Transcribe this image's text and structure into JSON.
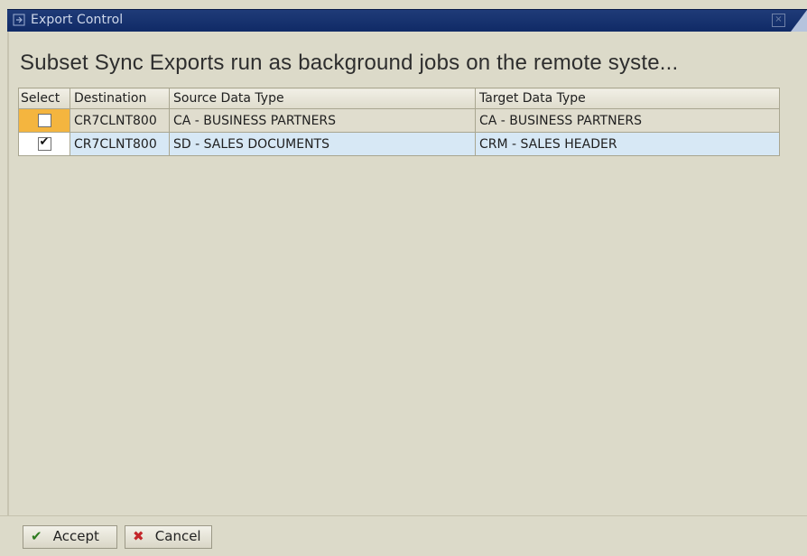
{
  "window": {
    "title": "Export Control"
  },
  "banner": {
    "text": "Subset Sync Exports run as background jobs on the remote syste..."
  },
  "table": {
    "columns": [
      "Select",
      "Destination",
      "Source Data Type",
      "Target Data Type"
    ],
    "rows": [
      {
        "selected": false,
        "destination": "CR7CLNT800",
        "source": "CA - BUSINESS PARTNERS",
        "target": "CA - BUSINESS PARTNERS",
        "checkmark": ""
      },
      {
        "selected": true,
        "destination": "CR7CLNT800",
        "source": "SD - SALES DOCUMENTS",
        "target": "CRM - SALES HEADER",
        "checkmark": "✔"
      }
    ]
  },
  "footer": {
    "accept_label": "Accept",
    "cancel_label": "Cancel",
    "accept_icon": "checkmark-icon",
    "cancel_icon": "cross-icon"
  },
  "colors": {
    "titlebar": "#102a66",
    "selected_row": "#d7e8f5",
    "focus_cell": "#f4b53f"
  }
}
